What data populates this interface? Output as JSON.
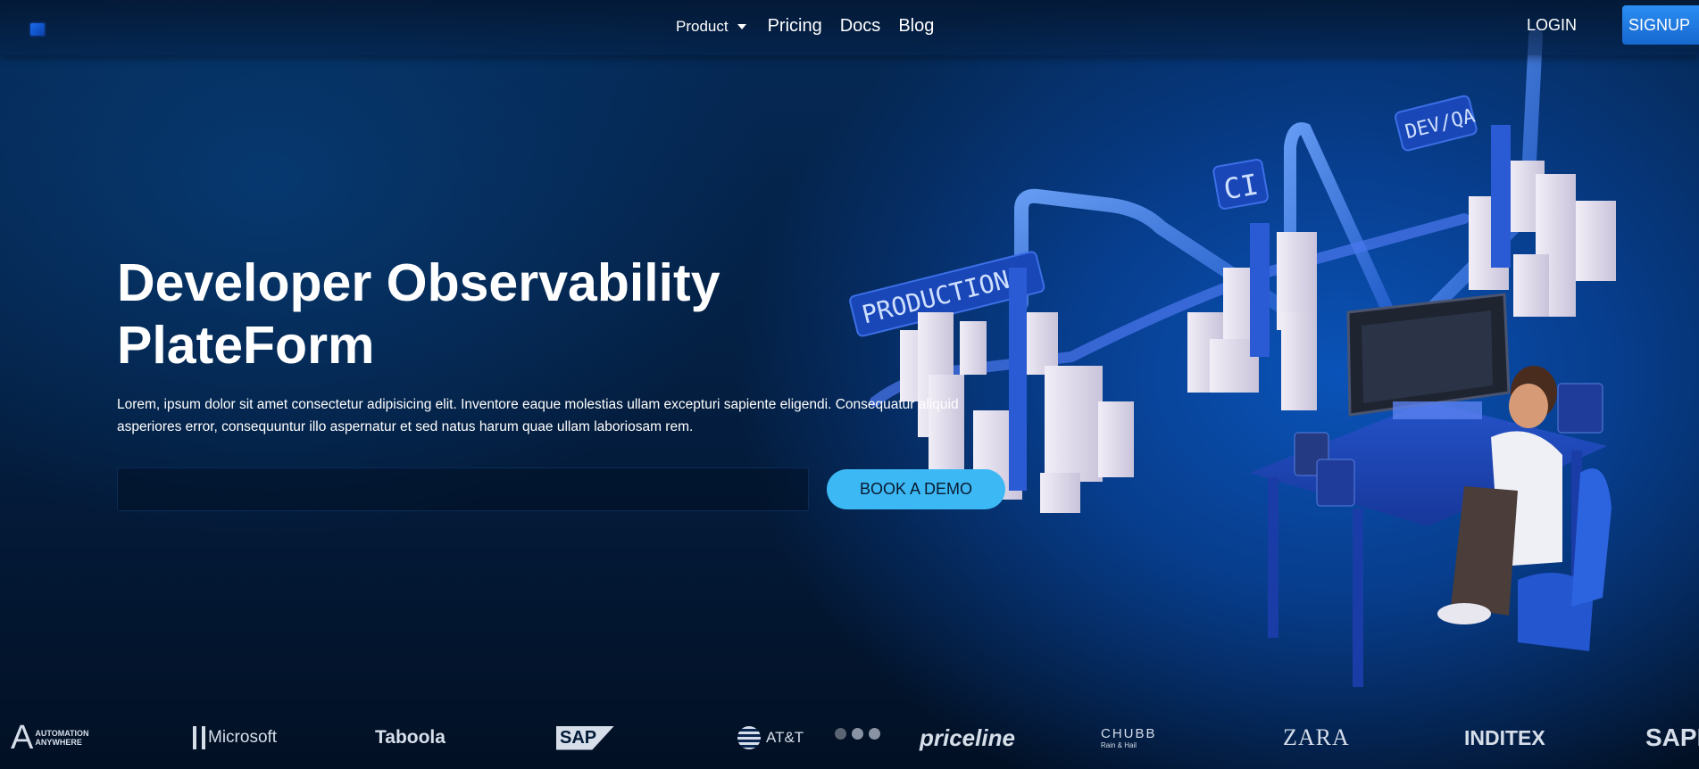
{
  "nav": {
    "product_label": "Product",
    "links": [
      "Pricing",
      "Docs",
      "Blog"
    ],
    "login_label": "LOGIN",
    "signup_label": "SIGNUP"
  },
  "hero": {
    "title_line1": "Developer Observability",
    "title_line2": "PlateForm",
    "description": "Lorem, ipsum dolor sit amet consectetur adipisicing elit. Inventore eaque molestias ullam excepturi sapiente eligendi. Consequatur aliquid asperiores error, consequuntur illo aspernatur et sed natus harum quae ullam laboriosam rem.",
    "email_value": "",
    "cta_label": "BOOK A DEMO"
  },
  "illustration": {
    "labels": [
      "PRODUCTION",
      "CI",
      "DEV/QA"
    ]
  },
  "clients": [
    {
      "name": "AUTOMATION ANYWHERE",
      "icon": "automation-anywhere-logo"
    },
    {
      "name": "Microsoft",
      "icon": "microsoft-logo"
    },
    {
      "name": "Taboola",
      "icon": "taboola-logo"
    },
    {
      "name": "SAP",
      "icon": "sap-logo"
    },
    {
      "name": "AT&T",
      "icon": "att-logo"
    },
    {
      "name": "priceline",
      "icon": "priceline-logo"
    },
    {
      "name": "CHUBB",
      "sub": "Rain & Hail",
      "icon": "chubb-logo"
    },
    {
      "name": "ZARA",
      "icon": "zara-logo"
    },
    {
      "name": "INDITEX",
      "icon": "inditex-logo"
    },
    {
      "name": "SAPIENS",
      "icon": "sapiens-logo"
    }
  ],
  "carousel": {
    "dot_count": 3,
    "active_index": 0
  },
  "colors": {
    "accent": "#3cb8f5",
    "signup": "#2b8df2",
    "background": "#041c3c"
  }
}
